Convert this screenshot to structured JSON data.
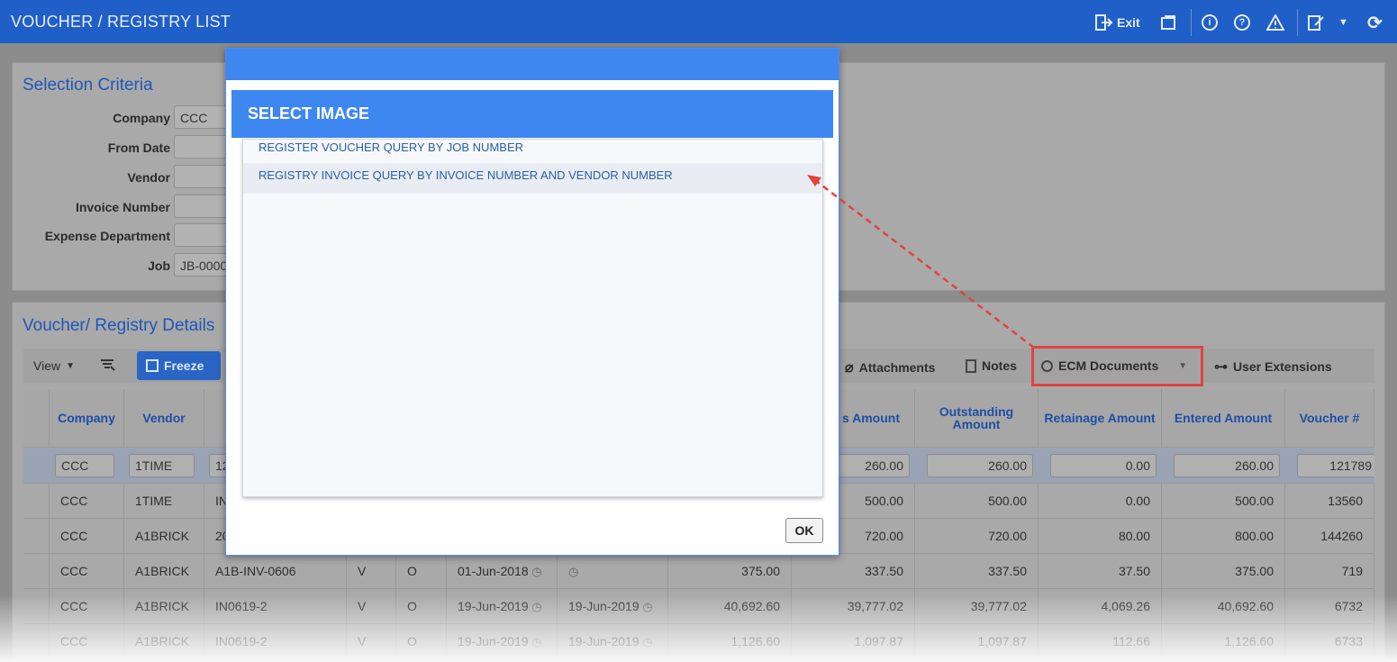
{
  "app": {
    "title": "VOUCHER / REGISTRY LIST",
    "exit_label": "Exit"
  },
  "selection": {
    "title": "Selection Criteria",
    "fields": [
      {
        "label": "Company",
        "value": "CCC"
      },
      {
        "label": "From Date",
        "value": ""
      },
      {
        "label": "Vendor",
        "value": ""
      },
      {
        "label": "Invoice Number",
        "value": ""
      },
      {
        "label": "Expense Department",
        "value": ""
      },
      {
        "label": "Job",
        "value": "JB-0000"
      }
    ]
  },
  "details": {
    "title": "Voucher/ Registry Details",
    "toolbar": {
      "view": "View",
      "freeze": "Freeze",
      "attachments": "Attachments",
      "notes": "Notes",
      "ecm": "ECM Documents",
      "user_ext": "User Extensions"
    },
    "columns": [
      "Company",
      "Vendor",
      "s Amount",
      "Outstanding Amount",
      "Retainage Amount",
      "Entered Amount",
      "Voucher #"
    ],
    "filter": [
      "CCC",
      "1TIME",
      "12",
      "260.00",
      "260.00",
      "0.00",
      "260.00",
      "121789"
    ],
    "rows": [
      [
        "CCC",
        "1TIME",
        "IN",
        "",
        "",
        "",
        "",
        "",
        "500.00",
        "500.00",
        "0.00",
        "500.00",
        "13560"
      ],
      [
        "CCC",
        "A1BRICK",
        "20",
        "",
        "",
        "",
        "",
        "",
        "720.00",
        "720.00",
        "80.00",
        "800.00",
        "144260"
      ],
      [
        "CCC",
        "A1BRICK",
        "A1B-INV-0606",
        "V",
        "O",
        "01-Jun-2018",
        "",
        "375.00",
        "337.50",
        "337.50",
        "37.50",
        "375.00",
        "719"
      ],
      [
        "CCC",
        "A1BRICK",
        "IN0619-2",
        "V",
        "O",
        "19-Jun-2019",
        "19-Jun-2019",
        "40,692.60",
        "39,777.02",
        "39,777.02",
        "4,069.26",
        "40,692.60",
        "6732"
      ],
      [
        "CCC",
        "A1BRICK",
        "IN0619-2",
        "V",
        "O",
        "19-Jun-2019",
        "19-Jun-2019",
        "1,126.60",
        "1,097.87",
        "1,097.87",
        "112.66",
        "1,126.60",
        "6733"
      ]
    ]
  },
  "modal": {
    "title": "SELECT IMAGE",
    "items": [
      "REGISTER VOUCHER QUERY BY JOB NUMBER",
      "REGISTRY INVOICE QUERY BY INVOICE NUMBER AND VENDOR NUMBER"
    ],
    "ok_label": "OK"
  },
  "colors": {
    "brand": "#1f5fc7",
    "modal_header": "#3f87f0",
    "highlight": "#e0443f",
    "link": "#2860a8"
  }
}
